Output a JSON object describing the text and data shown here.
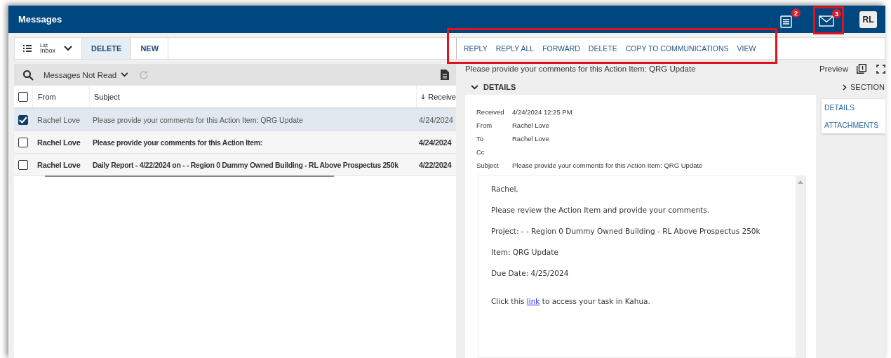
{
  "window": {
    "title": "Messages"
  },
  "header": {
    "tasks_badge": "2",
    "mail_badge": "3",
    "mail_highlighted": true,
    "avatar": "RL"
  },
  "toolbar": {
    "view_small": "List",
    "view": "Inbox",
    "buttons": [
      {
        "label": "DELETE",
        "selected": true
      },
      {
        "label": "NEW",
        "selected": false
      }
    ]
  },
  "actions": {
    "highlighted": true,
    "items": [
      "REPLY",
      "REPLY ALL",
      "FORWARD",
      "DELETE",
      "COPY TO COMMUNICATIONS",
      "VIEW"
    ]
  },
  "list": {
    "filter": "Messages Not Read",
    "all_checked": false,
    "columns": [
      "From",
      "Subject",
      "Receive"
    ],
    "rows": [
      {
        "from": "Rachel Love",
        "subject": "Please provide your comments for this Action Item: QRG Update",
        "received": "4/24/2024",
        "checked": true,
        "selected": true,
        "unread": false
      },
      {
        "from": "Rachel Love",
        "subject": "Please provide your comments for this Action Item:",
        "received": "4/24/2024",
        "checked": false,
        "selected": false,
        "unread": true
      },
      {
        "from": "Rachel Love",
        "subject": "Daily Report - 4/22/2024 on -  - Region 0 Dummy Owned Building - RL Above Prospectus 250k",
        "received": "4/22/2024",
        "checked": false,
        "selected": false,
        "unread": true
      }
    ]
  },
  "preview": {
    "title": "Please provide your comments for this Action Item: QRG Update",
    "mode": "Preview",
    "section_label": "DETAILS",
    "sections_toggle": "SECTION",
    "sections": [
      "DETAILS",
      "ATTACHMENTS"
    ],
    "fields": [
      {
        "label": "Received",
        "value": "4/24/2024 12:25 PM"
      },
      {
        "label": "From",
        "value": "Rachel Love"
      },
      {
        "label": "To",
        "value": "Rachel Love"
      },
      {
        "label": "Cc"
      },
      {
        "label": "Subject",
        "value": "Please provide your comments for this Action Item: QRG Update"
      }
    ],
    "body": [
      {
        "kind": "text",
        "text": "Rachel,"
      },
      {
        "kind": "text",
        "text": "Please review the Action Item and provide your comments."
      },
      {
        "kind": "text",
        "text": "Project: - - Region 0 Dummy Owned Building - RL Above Prospectus 250k"
      },
      {
        "kind": "text",
        "text": "Item: QRG Update"
      },
      {
        "kind": "text",
        "text": "Due Date: 4/25/2024"
      },
      {
        "kind": "link",
        "before": "Click this ",
        "link": "link",
        "after": " to access your task in Kahua."
      }
    ]
  }
}
